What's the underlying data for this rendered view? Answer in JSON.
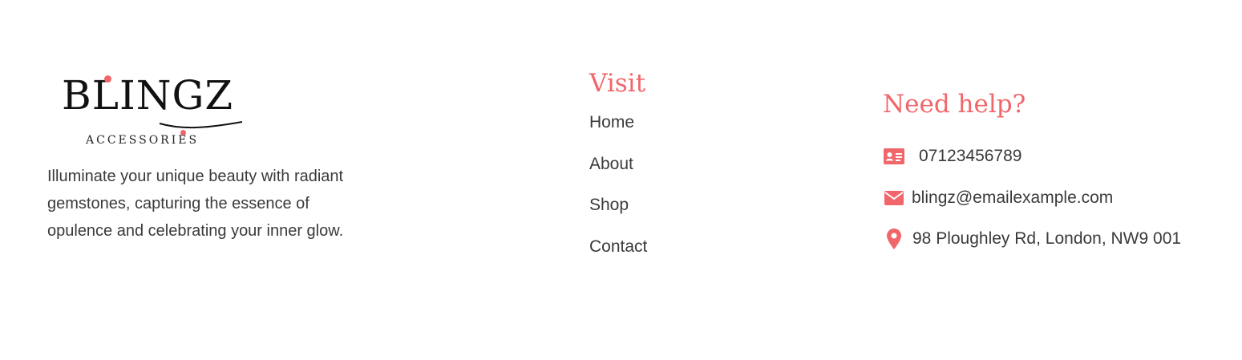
{
  "brand": {
    "logo_word": "BLINGZ",
    "logo_sub": "ACCESSORIES",
    "tagline": "Illuminate your unique beauty with radiant gemstones, capturing the essence of opulence and celebrating your inner glow."
  },
  "visit": {
    "title": "Visit",
    "links": [
      {
        "label": "Home"
      },
      {
        "label": "About"
      },
      {
        "label": "Shop"
      },
      {
        "label": "Contact"
      }
    ]
  },
  "help": {
    "title": "Need help?",
    "phone": {
      "icon": "id-card-icon",
      "text": "07123456789"
    },
    "email": {
      "icon": "envelope-icon",
      "text": "blingz@emailexample.com"
    },
    "address": {
      "icon": "map-pin-icon",
      "text": "98 Ploughley Rd, London, NW9 001"
    }
  },
  "colors": {
    "accent": "#f0666b",
    "text": "#3a3a3a",
    "logo": "#111111",
    "background": "#ffffff"
  }
}
